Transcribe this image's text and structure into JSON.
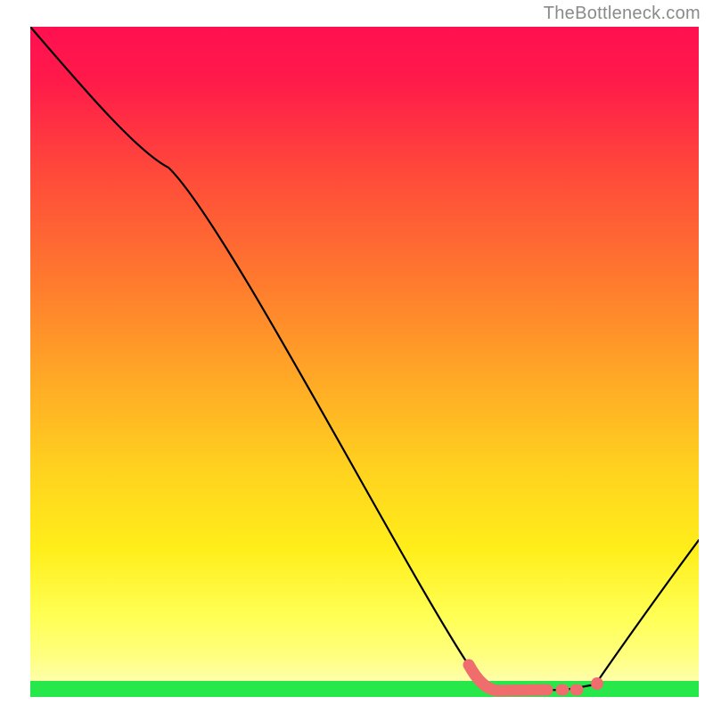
{
  "attribution": "TheBottleneck.com",
  "chart_data": {
    "type": "line",
    "title": "",
    "xlabel": "",
    "ylabel": "",
    "xlim": [
      0,
      100
    ],
    "ylim": [
      0,
      100
    ],
    "grid": false,
    "x": [
      0,
      20,
      66,
      70,
      82,
      84,
      85,
      100
    ],
    "values": [
      100,
      80,
      3,
      0,
      0,
      0,
      1,
      23
    ],
    "highlight_segments": [
      {
        "x": [
          66,
          70,
          75,
          78
        ],
        "values": [
          3,
          0,
          0,
          0
        ],
        "style": "thick"
      },
      {
        "x": [
          82,
          84
        ],
        "values": [
          0,
          0
        ],
        "style": "dot"
      }
    ],
    "gradient_bands": [
      {
        "start": 0.0,
        "end": 0.02,
        "color": "#26e84a"
      },
      {
        "start": 0.02,
        "end": 0.1,
        "color": "#ffff66"
      }
    ],
    "gradient_stops": [
      {
        "at": 0.0,
        "color": "#ff1744"
      },
      {
        "at": 0.25,
        "color": "#ff5722"
      },
      {
        "at": 0.5,
        "color": "#ffb300"
      },
      {
        "at": 0.75,
        "color": "#ffee00"
      },
      {
        "at": 0.9,
        "color": "#ffff66"
      },
      {
        "at": 1.0,
        "color": "#26e84a"
      }
    ]
  }
}
